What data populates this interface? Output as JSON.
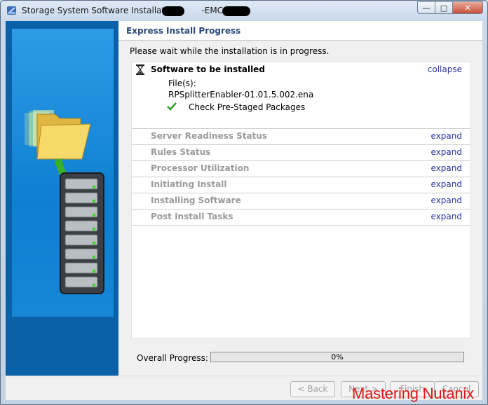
{
  "window": {
    "title": "Storage System Software Installation - ",
    "title_middle": "-EMC-VNX",
    "controls": {
      "minimize": "—",
      "maximize": "□",
      "close": "✕"
    }
  },
  "header": {
    "title": "Express Install Progress"
  },
  "status_text": "Please wait while the installation is in progress.",
  "steps": [
    {
      "title": "Software to be installed",
      "link": "collapse",
      "expanded": true,
      "icon": "hourglass-icon"
    },
    {
      "title": "Server Readiness Status",
      "link": "expand"
    },
    {
      "title": "Rules Status",
      "link": "expand"
    },
    {
      "title": "Processor Utilization",
      "link": "expand"
    },
    {
      "title": "Initiating Install",
      "link": "expand"
    },
    {
      "title": "Installing Software",
      "link": "expand"
    },
    {
      "title": "Post Install Tasks",
      "link": "expand"
    }
  ],
  "details": {
    "files_label": "File(s):",
    "file_name": "RPSplitterEnabler-01.01.5.002.ena",
    "check_item": "Check Pre-Staged Packages",
    "check_icon": "checkmark-icon"
  },
  "progress": {
    "label": "Overall Progress:",
    "value_text": "0%",
    "value": 0
  },
  "buttons": {
    "back": "< Back",
    "next": "Next >",
    "finish": "Finish",
    "cancel": "Cancel"
  },
  "watermark": "Mastering Nutanix",
  "colors": {
    "accent": "#0a61a8",
    "header_title": "#2b4a7a",
    "link": "#2a35a5",
    "watermark": "#e01717"
  }
}
